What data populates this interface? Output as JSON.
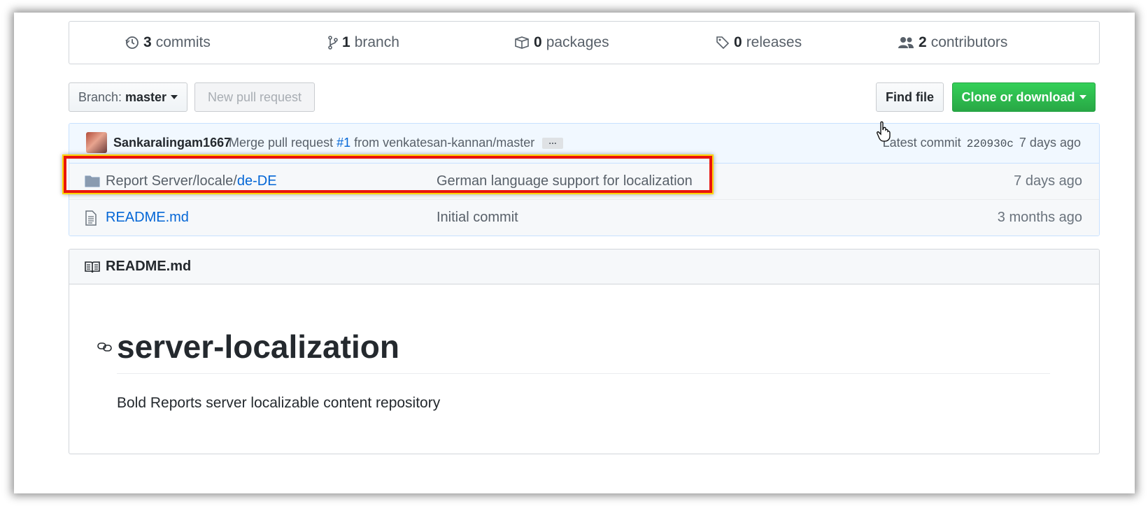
{
  "summary": {
    "commits": {
      "num": "3",
      "label": "commits",
      "icon": "history-icon"
    },
    "branch": {
      "num": "1",
      "label": "branch",
      "icon": "branch-icon"
    },
    "packages": {
      "num": "0",
      "label": "packages",
      "icon": "package-icon"
    },
    "releases": {
      "num": "0",
      "label": "releases",
      "icon": "tag-icon"
    },
    "contributors": {
      "num": "2",
      "label": "contributors",
      "icon": "people-icon"
    }
  },
  "toolbar": {
    "branch_label": "Branch:",
    "branch_value": "master",
    "new_pr": "New pull request",
    "find_file": "Find file",
    "clone": "Clone or download"
  },
  "commit": {
    "author": "Sankaralingam1667",
    "msg_before": "Merge pull request",
    "pr_link": "#1",
    "msg_after": "from venkatesan-kannan/master",
    "ellipsis": "…",
    "latest_label": "Latest commit",
    "sha": "220930c",
    "age": "7 days ago"
  },
  "files": [
    {
      "name_prefix": "Report Server/locale/",
      "name_link": "de-DE",
      "message": "German language support for localization",
      "age": "7 days ago",
      "icon": "folder-icon"
    },
    {
      "name_prefix": "",
      "name_link": "README.md",
      "message": "Initial commit",
      "age": "3 months ago",
      "icon": "file-icon"
    }
  ],
  "readme": {
    "header": "README.md",
    "title": "server-localization",
    "description": "Bold Reports server localizable content repository"
  },
  "colors": {
    "link": "#0366d6",
    "clone_button": "#28a745",
    "highlight_border": "#e8140e",
    "commit_row_bg": "#f1f8ff"
  }
}
